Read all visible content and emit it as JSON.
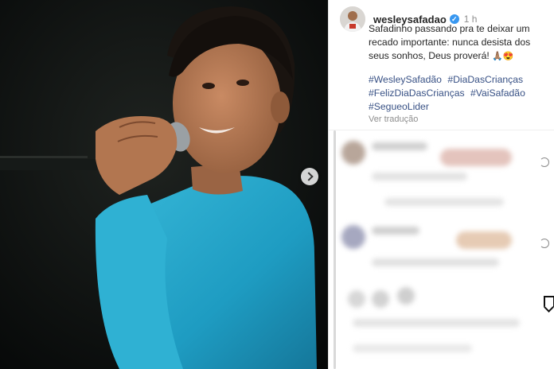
{
  "post": {
    "username": "wesleysafadao",
    "verified_icon": "verified-badge-icon",
    "timestamp": "1 h",
    "caption": "Safadinho passando pra te deixar um recado importante: nunca desista dos seus sonhos, Deus proverá!",
    "caption_emoji": "🙏🏽😍",
    "hashtags": [
      "#WesleySafadão",
      "#DiaDasCrianças",
      "#FelizDiaDasCrianças",
      "#VaiSafadão",
      "#SegueoLider"
    ],
    "see_translation": "Ver tradução",
    "carousel_next_icon": "chevron-right-icon"
  },
  "colors": {
    "hashtag": "#385185",
    "verified": "#3897f0",
    "shirt": "#2aa8c9"
  }
}
